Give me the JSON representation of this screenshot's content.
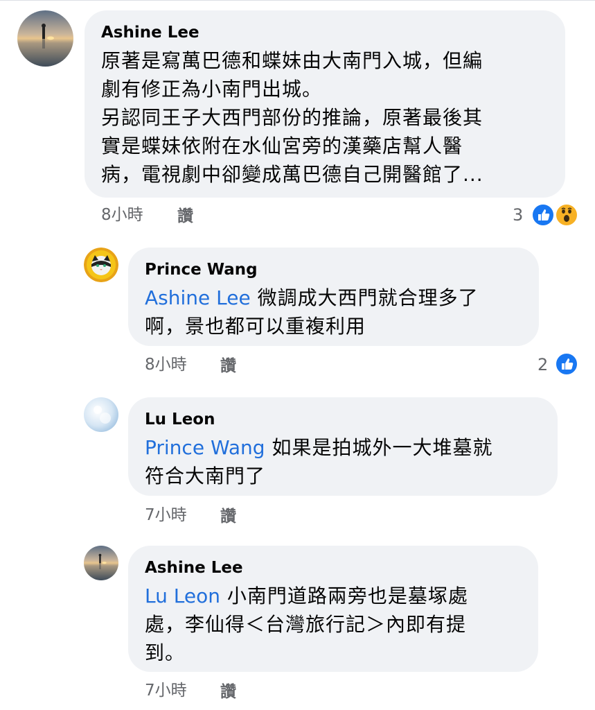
{
  "colors": {
    "bubble": "#f0f2f5",
    "mention": "#216fdb",
    "meta": "#65676b",
    "like_blue": "#1877f2",
    "wow_yellow": "#f7b125"
  },
  "comments": [
    {
      "author": "Ashine Lee",
      "text_lines": [
        "原著是寫萬巴德和蝶妹由大南門入城，但編",
        "劇有修正為小南門出城。",
        "另認同王子大西門部份的推論，原著最後其",
        "實是蝶妹依附在水仙宮旁的漢藥店幫人醫",
        "病，電視劇中卻變成萬巴德自己開醫館了..."
      ],
      "time": "8小時",
      "like_label": "讚",
      "reaction_count": "3",
      "reactions": [
        "like-icon",
        "wow-icon"
      ]
    },
    {
      "author": "Prince Wang",
      "mention": "Ashine Lee",
      "text_line1": "微調成大西門就合理多了",
      "text_line2": "啊，景也都可以重複利用",
      "time": "8小時",
      "like_label": "讚",
      "reaction_count": "2",
      "reactions": [
        "like-icon"
      ]
    },
    {
      "author": "Lu Leon",
      "mention": "Prince Wang",
      "text_line1": "如果是拍城外一大堆墓就",
      "text_line2": "符合大南門了",
      "time": "7小時",
      "like_label": "讚"
    },
    {
      "author": "Ashine Lee",
      "mention": "Lu Leon",
      "text_line1": "小南門道路兩旁也是墓塚處",
      "text_line2": "處，李仙得＜台灣旅行記＞內即有提",
      "text_line3": "到。",
      "time": "7小時",
      "like_label": "讚"
    }
  ]
}
